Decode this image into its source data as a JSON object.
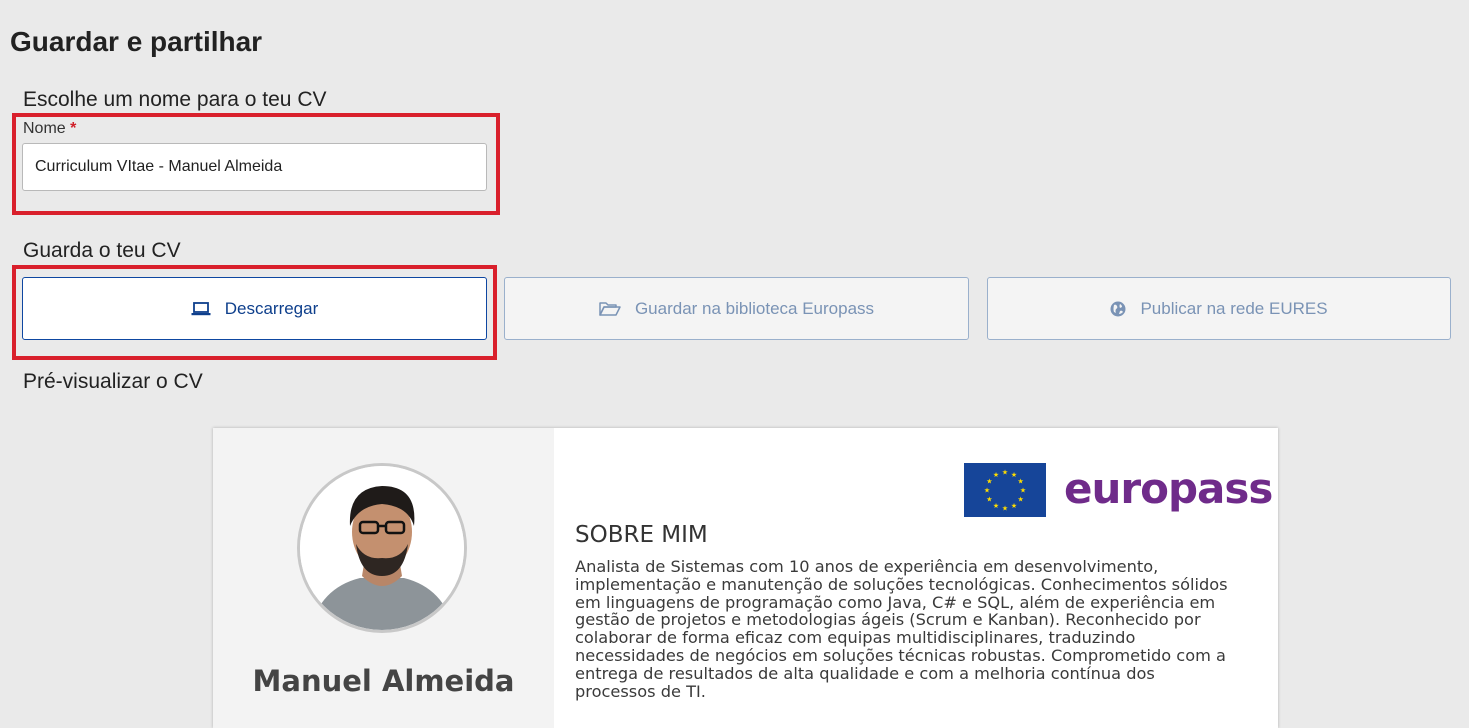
{
  "page": {
    "title": "Guardar e partilhar"
  },
  "name_section": {
    "heading": "Escolhe um nome para o teu CV",
    "field_label": "Nome",
    "required_mark": "*",
    "value": "Curriculum VItae - Manuel Almeida"
  },
  "save_section": {
    "heading": "Guarda o teu CV",
    "download_label": "Descarregar",
    "download_icon": "laptop-icon",
    "library_label": "Guardar na biblioteca Europass",
    "library_icon": "folder-open-icon",
    "eures_label": "Publicar na rede EURES",
    "eures_icon": "globe-icon"
  },
  "preview_section": {
    "heading": "Pré-visualizar o CV",
    "person_name": "Manuel Almeida",
    "logo_text": "europass",
    "about_title": "SOBRE MIM",
    "about_lines": [
      "Analista de Sistemas com 10 anos de experiência em desenvolvimento,",
      "implementação e manutenção de soluções tecnológicas. Conhecimentos sólidos",
      "em linguagens de programação como Java, C# e SQL, além de experiência em",
      "gestão de projetos e metodologias ágeis (Scrum e Kanban). Reconhecido por",
      "colaborar de forma eficaz com equipas multidisciplinares, traduzindo",
      "necessidades de negócios em soluções técnicas robustas. Comprometido com a",
      "entrega de resultados de alta qualidade e com a melhoria contínua dos",
      "processos de TI."
    ]
  },
  "colors": {
    "highlight": "#d9202c",
    "primary": "#0e47a1",
    "europass_purple": "#6f2b8a",
    "eu_blue": "#164599",
    "eu_star": "#ffdd00"
  }
}
